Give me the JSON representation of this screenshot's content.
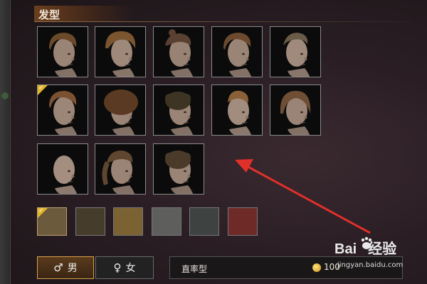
{
  "header": {
    "title": "发型"
  },
  "hairstyles": [
    {
      "name": "hair-1",
      "hair": "#6b4a2a",
      "skin": "#9a8476",
      "selected": false,
      "style": "side"
    },
    {
      "name": "hair-2",
      "hair": "#7a5530",
      "skin": "#9e887a",
      "selected": false,
      "style": "messy"
    },
    {
      "name": "hair-3",
      "hair": "#5a4030",
      "skin": "#988274",
      "selected": false,
      "style": "bun"
    },
    {
      "name": "hair-4",
      "hair": "#6d4a2e",
      "skin": "#9a8476",
      "selected": false,
      "style": "slick"
    },
    {
      "name": "hair-5",
      "hair": "#6a5a48",
      "skin": "#a08a7c",
      "selected": false,
      "style": "fade"
    },
    {
      "name": "hair-6",
      "hair": "#7a5232",
      "skin": "#9c8678",
      "selected": true,
      "style": "side"
    },
    {
      "name": "hair-7",
      "hair": "#5a3a22",
      "skin": "#9a8476",
      "selected": false,
      "style": "afro"
    },
    {
      "name": "hair-8",
      "hair": "#3e3424",
      "skin": "#9a8476",
      "selected": false,
      "style": "curly"
    },
    {
      "name": "hair-9",
      "hair": "#8a6038",
      "skin": "#a28c7e",
      "selected": false,
      "style": "undercut"
    },
    {
      "name": "hair-10",
      "hair": "#6e4e34",
      "skin": "#9a8476",
      "selected": false,
      "style": "shaggy"
    },
    {
      "name": "hair-11",
      "hair": "#9a8070",
      "skin": "#a48e80",
      "selected": false,
      "style": "bald"
    },
    {
      "name": "hair-12",
      "hair": "#5e4630",
      "skin": "#9a8476",
      "selected": false,
      "style": "ponytail"
    },
    {
      "name": "hair-13",
      "hair": "#4a3a2a",
      "skin": "#9a8476",
      "selected": false,
      "style": "curly"
    }
  ],
  "hair_colors": [
    "#6b5a3c",
    "#463c2c",
    "#7a6232",
    "#5e5e5c",
    "#3e4240",
    "#6e2a26"
  ],
  "selected_color_index": 0,
  "gender": {
    "male_symbol": "♂",
    "male_label": "男",
    "female_symbol": "♀",
    "female_label": "女",
    "selected": "male"
  },
  "style_bar": {
    "label": "直率型",
    "price": "100"
  },
  "watermark": {
    "logo_text": "Bai",
    "logo_suffix": "经验",
    "url": "jingyan.baidu.com"
  }
}
